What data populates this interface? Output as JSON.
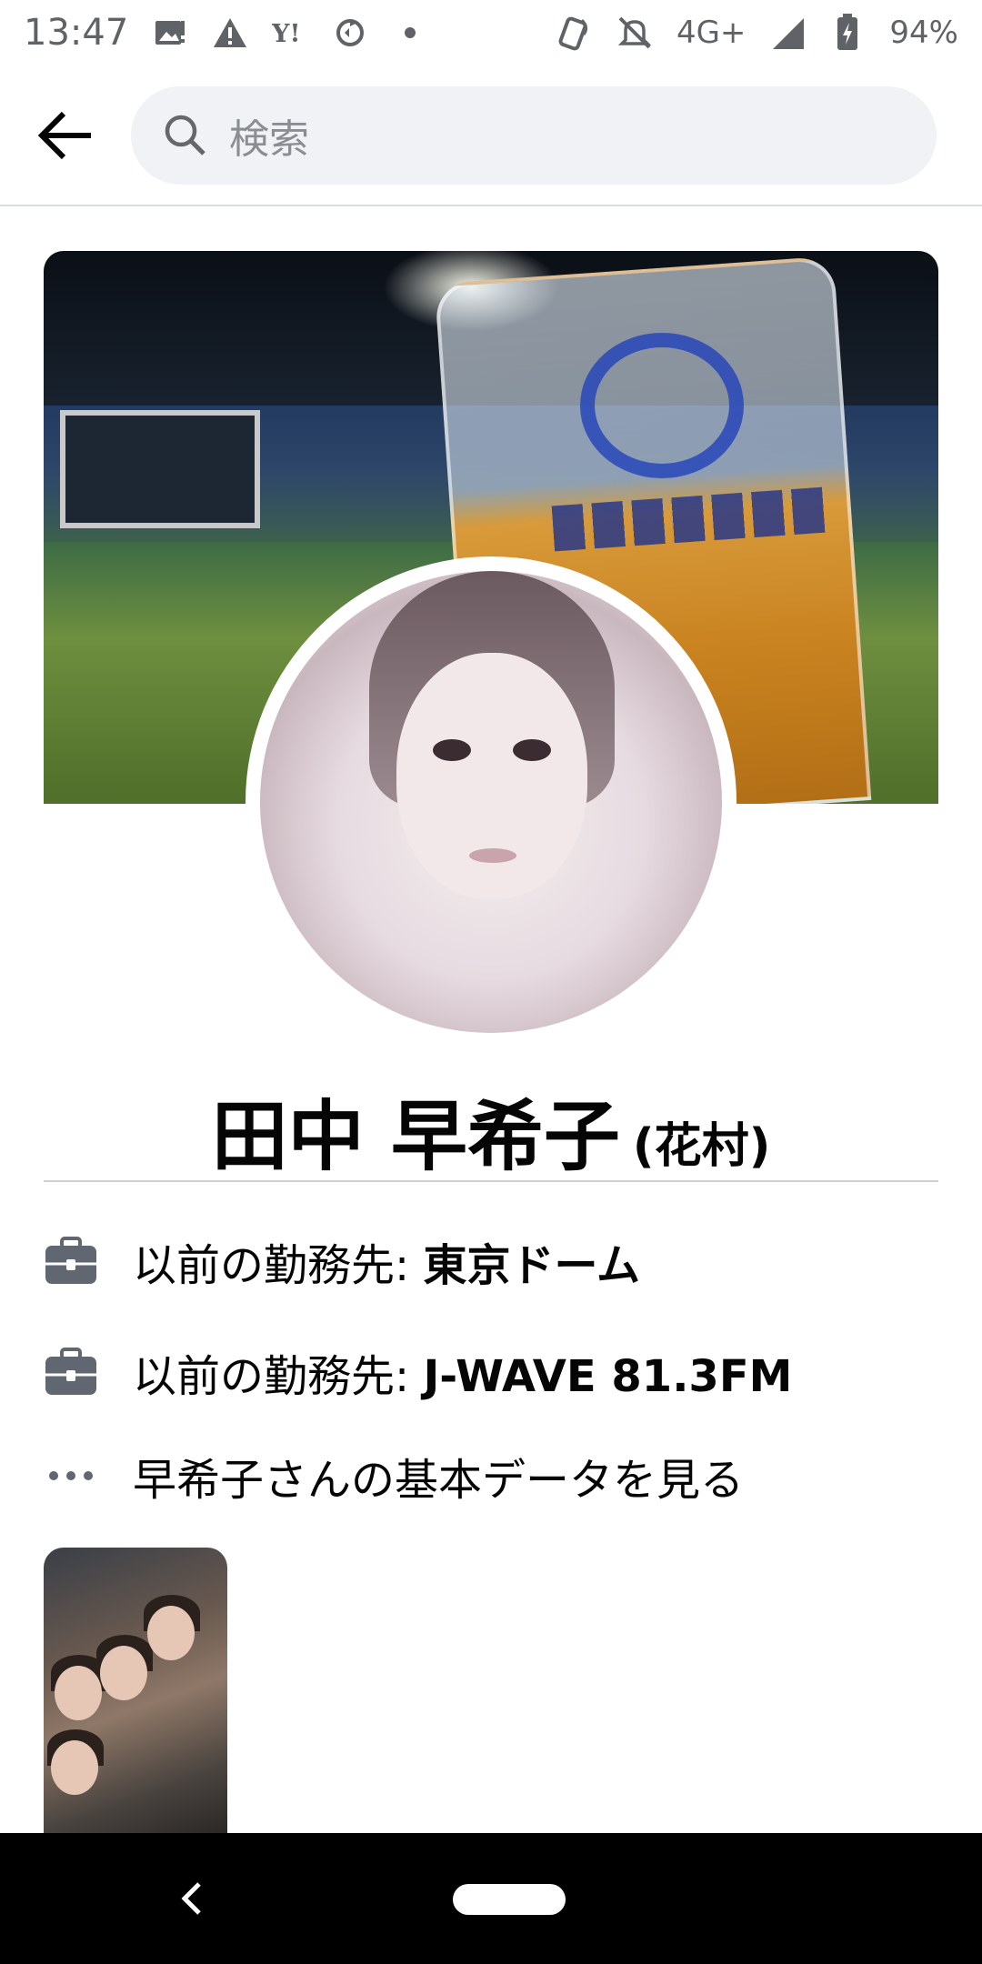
{
  "status_bar": {
    "time": "13:47",
    "network": "4G+",
    "battery": "94%",
    "left_icons": [
      "image-notification-icon",
      "warning-icon",
      "yahoo-icon",
      "sync-icon",
      "dot-icon"
    ],
    "right_icons": [
      "nfc-icon",
      "mute-icon",
      "signal-icon",
      "battery-icon"
    ]
  },
  "header": {
    "search_placeholder": "検索",
    "back_icon": "back-arrow-icon",
    "search_icon": "search-icon"
  },
  "profile": {
    "name": "田中 早希子",
    "alt_name": "(花村)"
  },
  "info": {
    "items": [
      {
        "icon": "briefcase-icon",
        "prefix": "以前の勤務先: ",
        "value": "東京ドーム"
      },
      {
        "icon": "briefcase-icon",
        "prefix": "以前の勤務先: ",
        "value": "J-WAVE 81.3FM"
      },
      {
        "icon": "more-icon",
        "prefix": "早希子さんの基本データを見る",
        "value": ""
      }
    ]
  },
  "nav": {
    "back_icon": "nav-back-icon",
    "home_icon": "home-pill-icon"
  },
  "colors": {
    "background": "#ffffff",
    "search_bg": "#f0f2f5",
    "divider": "#dadde1",
    "icon_gray": "#606770",
    "nav_bar": "#000000"
  }
}
